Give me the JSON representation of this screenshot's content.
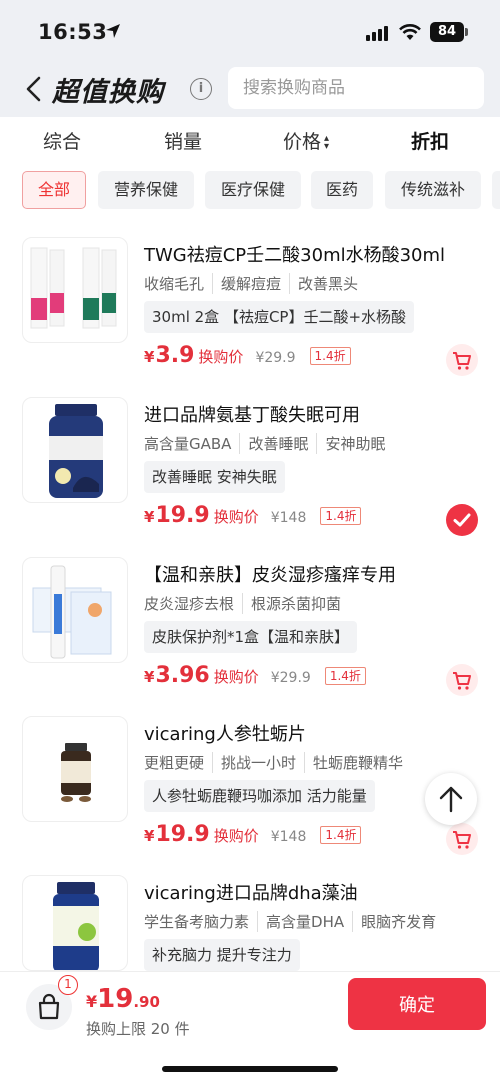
{
  "status_bar": {
    "time": "16:53",
    "battery": "84"
  },
  "header": {
    "title": "超值换购",
    "info_icon": "info-icon",
    "search_placeholder": "搜索换购商品"
  },
  "sort_tabs": [
    {
      "label": "综合"
    },
    {
      "label": "销量"
    },
    {
      "label": "价格"
    },
    {
      "label": "折扣"
    }
  ],
  "categories": [
    {
      "label": "全部",
      "active": true
    },
    {
      "label": "营养保健"
    },
    {
      "label": "医疗保健"
    },
    {
      "label": "医药"
    },
    {
      "label": "传统滋补"
    }
  ],
  "products": [
    {
      "name": "TWG祛痘CP壬二酸30ml水杨酸30ml",
      "tags": [
        "收缩毛孔",
        "缓解痘痘",
        "改善黑头"
      ],
      "spec": "30ml 2盒 【祛痘CP】壬二酸+水杨酸",
      "price": "3.9",
      "price_label": "换购价",
      "original": "¥29.9",
      "discount": "1.4折",
      "action": "cart"
    },
    {
      "name": "进口品牌氨基丁酸失眠可用",
      "tags": [
        "高含量GABA",
        "改善睡眠",
        "安神助眠"
      ],
      "spec": "改善睡眠 安神失眠",
      "price": "19.9",
      "price_label": "换购价",
      "original": "¥148",
      "discount": "1.4折",
      "action": "selected"
    },
    {
      "name": "【温和亲肤】皮炎湿疹瘙痒专用",
      "tags": [
        "皮炎湿疹去根",
        "根源杀菌抑菌"
      ],
      "spec": "皮肤保护剂*1盒【温和亲肤】",
      "price": "3.96",
      "price_label": "换购价",
      "original": "¥29.9",
      "discount": "1.4折",
      "action": "cart"
    },
    {
      "name": "vicaring人参牡蛎片",
      "tags": [
        "更粗更硬",
        "挑战一小时",
        "牡蛎鹿鞭精华"
      ],
      "spec": "人参牡蛎鹿鞭玛咖添加 活力能量",
      "price": "19.9",
      "price_label": "换购价",
      "original": "¥148",
      "discount": "1.4折",
      "action": "cart"
    },
    {
      "name": "vicaring进口品牌dha藻油",
      "tags": [
        "学生备考脑力素",
        "高含量DHA",
        "眼脑齐发育"
      ],
      "spec": "补充脑力 提升专注力",
      "price": "",
      "price_label": "",
      "original": "",
      "discount": "",
      "action": "none"
    }
  ],
  "footer": {
    "cart_count": "1",
    "currency": "¥",
    "total_int": "19",
    "total_dec": ".90",
    "limit_text": "换购上限 20 件",
    "confirm_label": "确定"
  },
  "colors": {
    "accent": "#ee3344",
    "price": "#e3303b",
    "header_bg": "#eef0f4"
  }
}
